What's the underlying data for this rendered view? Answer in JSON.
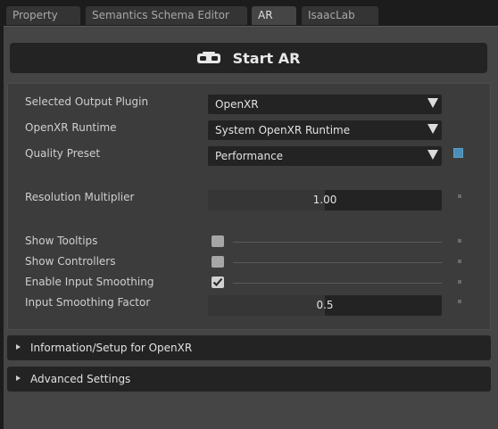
{
  "tabs": [
    {
      "label": "Property"
    },
    {
      "label": "Semantics Schema Editor"
    },
    {
      "label": "AR"
    },
    {
      "label": "IsaacLab"
    }
  ],
  "start_button": {
    "label": "Start AR",
    "icon": "vr-headset-icon"
  },
  "settings": {
    "output_plugin": {
      "label": "Selected Output Plugin",
      "value": "OpenXR"
    },
    "runtime": {
      "label": "OpenXR Runtime",
      "value": "System OpenXR Runtime"
    },
    "quality": {
      "label": "Quality Preset",
      "value": "Performance"
    },
    "resolution": {
      "label": "Resolution Multiplier",
      "value": "1.00"
    },
    "tooltips": {
      "label": "Show Tooltips",
      "checked": false
    },
    "controllers": {
      "label": "Show Controllers",
      "checked": false
    },
    "input_smoothing": {
      "label": "Enable Input Smoothing",
      "checked": true
    },
    "smoothing_factor": {
      "label": "Input Smoothing Factor",
      "value": "0.5",
      "fill_fraction": 0.5
    }
  },
  "sections": [
    {
      "label": "Information/Setup for OpenXR",
      "expanded": false
    },
    {
      "label": "Advanced Settings",
      "expanded": false
    }
  ],
  "colors": {
    "panel": "#454545",
    "field": "#232323",
    "accent": "#4a8fb8"
  }
}
